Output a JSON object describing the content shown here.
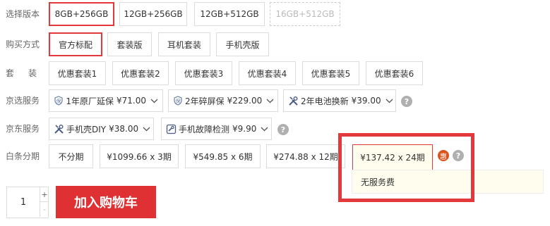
{
  "version": {
    "label": "选择版本",
    "options": [
      "8GB+256GB",
      "12GB+256GB",
      "12GB+512GB",
      "16GB+512GB"
    ]
  },
  "purchase": {
    "label": "购买方式",
    "options": [
      "官方标配",
      "套装版",
      "耳机套装",
      "手机壳版"
    ]
  },
  "bundle": {
    "label": "套装",
    "options": [
      "优惠套装1",
      "优惠套装2",
      "优惠套装3",
      "优惠套装4",
      "优惠套装5",
      "优惠套装6"
    ]
  },
  "jx_service": {
    "label": "京选服务",
    "items": [
      {
        "label": "1年原厂延保",
        "price": "¥71.00",
        "icon": "shield-icon"
      },
      {
        "label": "2年碎屏保",
        "price": "¥229.00",
        "icon": "shield-icon"
      },
      {
        "label": "2年电池换新",
        "price": "¥39.00",
        "icon": "tools-icon"
      }
    ]
  },
  "jd_service": {
    "label": "京东服务",
    "items": [
      {
        "label": "手机壳DIY",
        "price": "¥38.00",
        "icon": "tools-icon"
      },
      {
        "label": "手机故障检测",
        "price": "¥9.90",
        "icon": "repair-icon"
      }
    ]
  },
  "installment": {
    "label": "白条分期",
    "options": [
      "不分期",
      "¥1099.66 x 3期",
      "¥549.85 x 6期",
      "¥274.88 x 12期",
      "¥137.42 x 24期"
    ],
    "badge": "惠",
    "tooltip": "无服务费"
  },
  "quantity": {
    "value": "1",
    "plus": "+",
    "minus": "-"
  },
  "cart": {
    "label": "加入购物车"
  },
  "help": {
    "glyph": "?"
  },
  "colors": {
    "accent": "#e4393c",
    "cart_bg": "#df3033",
    "badge": "#d9531e"
  }
}
